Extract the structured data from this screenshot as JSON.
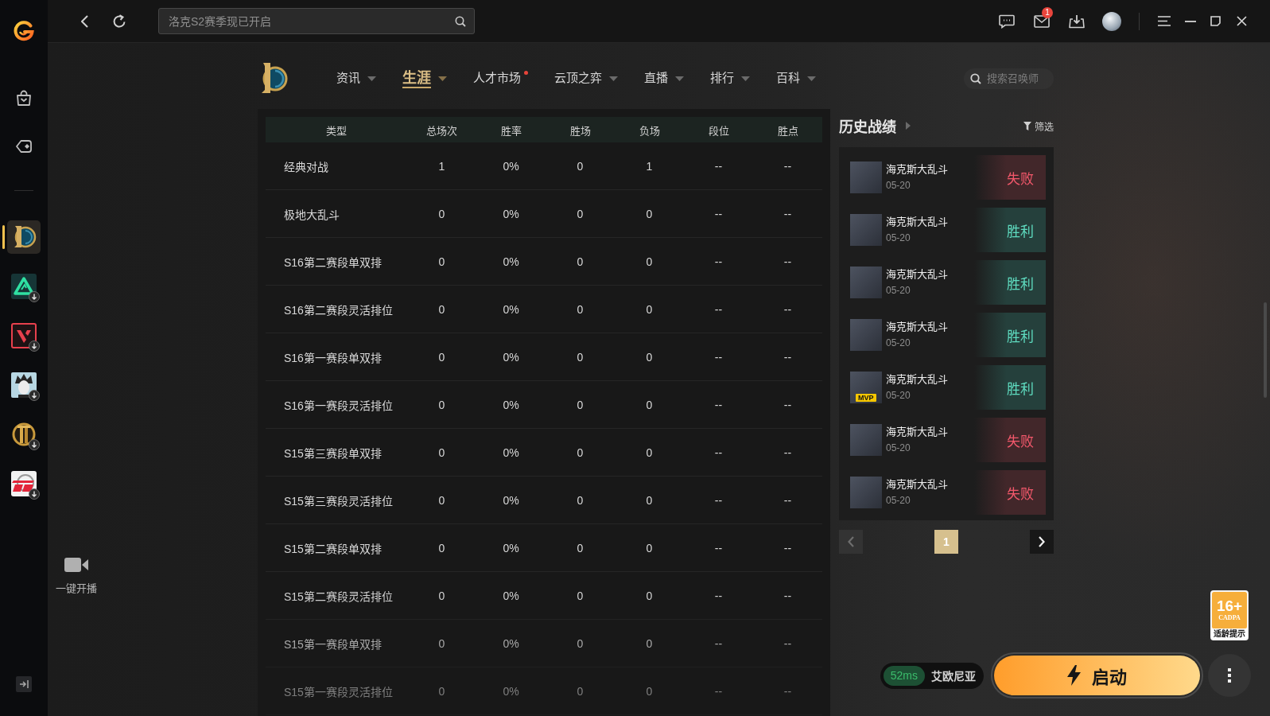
{
  "top_bar": {
    "search": {
      "placeholder": "洛克S2赛季现已开启"
    },
    "mail_count": "1"
  },
  "rail": {
    "apps": [
      {
        "kind": "emblem",
        "selected": true,
        "downloadable": false
      },
      {
        "kind": "triangle",
        "selected": false,
        "downloadable": true
      },
      {
        "kind": "chevron",
        "selected": false,
        "downloadable": true
      },
      {
        "kind": "portrait",
        "selected": false,
        "downloadable": true
      },
      {
        "kind": "crest",
        "selected": false,
        "downloadable": true
      },
      {
        "kind": "stripes",
        "selected": false,
        "downloadable": true
      }
    ]
  },
  "live_button": {
    "label": "一键开播"
  },
  "nav": {
    "items": [
      {
        "label": "资讯",
        "selected": false,
        "dropdown": true,
        "notify": false
      },
      {
        "label": "生涯",
        "selected": true,
        "dropdown": true,
        "notify": false
      },
      {
        "label": "人才市场",
        "selected": false,
        "dropdown": false,
        "notify": true
      },
      {
        "label": "云顶之弈",
        "selected": false,
        "dropdown": true,
        "notify": false
      },
      {
        "label": "直播",
        "selected": false,
        "dropdown": true,
        "notify": false
      },
      {
        "label": "排行",
        "selected": false,
        "dropdown": true,
        "notify": false
      },
      {
        "label": "百科",
        "selected": false,
        "dropdown": true,
        "notify": false
      }
    ],
    "search": {
      "placeholder": "搜索召唤师"
    }
  },
  "stats_table": {
    "columns": [
      "类型",
      "总场次",
      "胜率",
      "胜场",
      "负场",
      "段位",
      "胜点"
    ],
    "rows": [
      [
        "经典对战",
        "1",
        "0%",
        "0",
        "1",
        "--",
        "--"
      ],
      [
        "极地大乱斗",
        "0",
        "0%",
        "0",
        "0",
        "--",
        "--"
      ],
      [
        "S16第二赛段单双排",
        "0",
        "0%",
        "0",
        "0",
        "--",
        "--"
      ],
      [
        "S16第二赛段灵活排位",
        "0",
        "0%",
        "0",
        "0",
        "--",
        "--"
      ],
      [
        "S16第一赛段单双排",
        "0",
        "0%",
        "0",
        "0",
        "--",
        "--"
      ],
      [
        "S16第一赛段灵活排位",
        "0",
        "0%",
        "0",
        "0",
        "--",
        "--"
      ],
      [
        "S15第三赛段单双排",
        "0",
        "0%",
        "0",
        "0",
        "--",
        "--"
      ],
      [
        "S15第三赛段灵活排位",
        "0",
        "0%",
        "0",
        "0",
        "--",
        "--"
      ],
      [
        "S15第二赛段单双排",
        "0",
        "0%",
        "0",
        "0",
        "--",
        "--"
      ],
      [
        "S15第二赛段灵活排位",
        "0",
        "0%",
        "0",
        "0",
        "--",
        "--"
      ],
      [
        "S15第一赛段单双排",
        "0",
        "0%",
        "0",
        "0",
        "--",
        "--"
      ],
      [
        "S15第一赛段灵活排位",
        "0",
        "0%",
        "0",
        "0",
        "--",
        "--"
      ]
    ]
  },
  "match_history": {
    "title": "历史战绩",
    "filter": "筛选",
    "matches": [
      {
        "mode": "海克斯大乱斗",
        "date": "05-20",
        "result": "失败",
        "win": false
      },
      {
        "mode": "海克斯大乱斗",
        "date": "05-20",
        "result": "胜利",
        "win": true
      },
      {
        "mode": "海克斯大乱斗",
        "date": "05-20",
        "result": "胜利",
        "win": true
      },
      {
        "mode": "海克斯大乱斗",
        "date": "05-20",
        "result": "胜利",
        "win": true
      },
      {
        "mode": "海克斯大乱斗",
        "date": "05-20",
        "result": "胜利",
        "win": true,
        "badge": "MVP"
      },
      {
        "mode": "海克斯大乱斗",
        "date": "05-20",
        "result": "失败",
        "win": false
      },
      {
        "mode": "海克斯大乱斗",
        "date": "05-20",
        "result": "失败",
        "win": false
      }
    ],
    "pagination": {
      "prev": {
        "disabled": true
      },
      "pages": [
        {
          "label": "1",
          "selected": true
        }
      ],
      "next": {
        "disabled": false
      }
    }
  },
  "launch": {
    "ping": "52ms",
    "server": "艾欧尼亚",
    "button": "启动"
  },
  "age_rating": {
    "age": "16+",
    "org": "CADPA",
    "caption": "适龄提示"
  }
}
